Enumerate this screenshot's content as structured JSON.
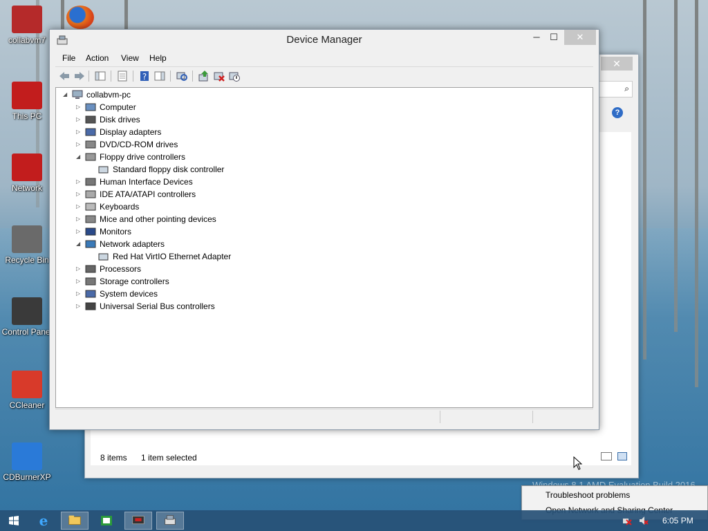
{
  "desktop": {
    "icons": [
      {
        "label": "collabvm7",
        "color": "#b52a2a"
      },
      {
        "label": "This PC",
        "color": "#c21d1d"
      },
      {
        "label": "Network",
        "color": "#c21d1d"
      },
      {
        "label": "Recycle Bin",
        "color": "#6a6a6a"
      },
      {
        "label": "Control Panel",
        "color": "#3a3a3a"
      },
      {
        "label": "CCleaner",
        "color": "#d83a2a"
      },
      {
        "label": "CDBurnerXP",
        "color": "#2a7ad8"
      }
    ],
    "watermark": "Windows 8.1 AMD Evaluation Build 2016"
  },
  "explorer_window": {
    "close_glyph": "✕",
    "help_glyph": "?",
    "status": {
      "items": "8 items",
      "selected": "1 item selected"
    }
  },
  "device_manager": {
    "title": "Device Manager",
    "buttons": {
      "minimize": "─",
      "maximize": "☐",
      "close": "✕"
    },
    "menu": [
      "File",
      "Action",
      "View",
      "Help"
    ],
    "toolbar_icons": [
      "back-icon",
      "forward-icon",
      "show-hide-tree-icon",
      "properties-icon",
      "help-icon",
      "show-hide-action-pane-icon",
      "scan-hardware-icon",
      "update-driver-icon",
      "uninstall-icon",
      "disable-device-icon"
    ],
    "root": "collabvm-pc",
    "nodes": [
      {
        "label": "Computer",
        "expanded": false,
        "icon": "computer-icon"
      },
      {
        "label": "Disk drives",
        "expanded": false,
        "icon": "disk-drive-icon"
      },
      {
        "label": "Display adapters",
        "expanded": false,
        "icon": "display-adapter-icon"
      },
      {
        "label": "DVD/CD-ROM drives",
        "expanded": false,
        "icon": "dvd-drive-icon"
      },
      {
        "label": "Floppy drive controllers",
        "expanded": true,
        "icon": "floppy-controller-icon",
        "children": [
          "Standard floppy disk controller"
        ]
      },
      {
        "label": "Human Interface Devices",
        "expanded": false,
        "icon": "hid-icon"
      },
      {
        "label": "IDE ATA/ATAPI controllers",
        "expanded": false,
        "icon": "ide-controller-icon"
      },
      {
        "label": "Keyboards",
        "expanded": false,
        "icon": "keyboard-icon"
      },
      {
        "label": "Mice and other pointing devices",
        "expanded": false,
        "icon": "mouse-icon"
      },
      {
        "label": "Monitors",
        "expanded": false,
        "icon": "monitor-icon"
      },
      {
        "label": "Network adapters",
        "expanded": true,
        "icon": "network-adapter-icon",
        "children": [
          "Red Hat VirtIO Ethernet Adapter"
        ]
      },
      {
        "label": "Processors",
        "expanded": false,
        "icon": "processor-icon"
      },
      {
        "label": "Storage controllers",
        "expanded": false,
        "icon": "storage-controller-icon"
      },
      {
        "label": "System devices",
        "expanded": false,
        "icon": "system-devices-icon"
      },
      {
        "label": "Universal Serial Bus controllers",
        "expanded": false,
        "icon": "usb-icon"
      }
    ]
  },
  "popup": {
    "items": [
      "Troubleshoot problems",
      "Open Network and Sharing Center"
    ]
  },
  "taskbar": {
    "clock": "6:05 PM",
    "apps": [
      "start-icon",
      "internet-explorer-icon",
      "file-explorer-icon",
      "store-icon",
      "remote-desktop-icon",
      "device-manager-icon"
    ]
  },
  "colors": {
    "accent": "#2f6cc6",
    "taskbar": "#265076",
    "close_inactive": "#c7c7c7"
  }
}
